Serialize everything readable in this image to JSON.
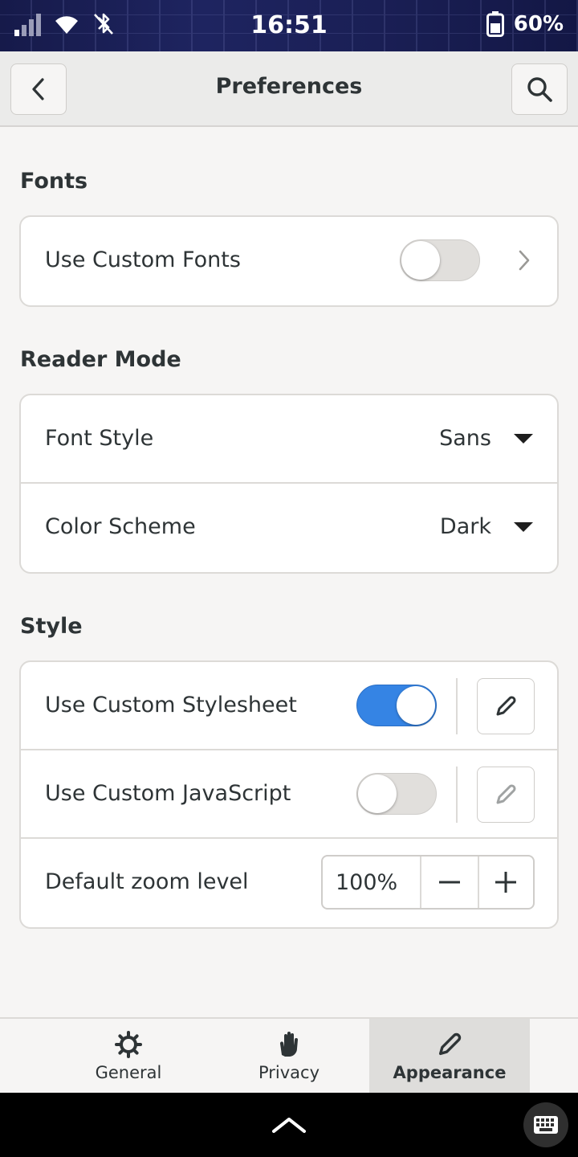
{
  "status_bar": {
    "time": "16:51",
    "battery": "60%"
  },
  "header": {
    "title": "Preferences"
  },
  "fonts": {
    "section_title": "Fonts",
    "use_custom_fonts": {
      "label": "Use Custom Fonts",
      "enabled": false
    }
  },
  "reader_mode": {
    "section_title": "Reader Mode",
    "font_style": {
      "label": "Font Style",
      "value": "Sans"
    },
    "color_scheme": {
      "label": "Color Scheme",
      "value": "Dark"
    }
  },
  "style": {
    "section_title": "Style",
    "custom_stylesheet": {
      "label": "Use Custom Stylesheet",
      "enabled": true
    },
    "custom_javascript": {
      "label": "Use Custom JavaScript",
      "enabled": false
    },
    "zoom": {
      "label": "Default zoom level",
      "value": "100%"
    }
  },
  "tabs": [
    {
      "label": "General",
      "icon": "gear-icon",
      "active": false
    },
    {
      "label": "Privacy",
      "icon": "hand-icon",
      "active": false
    },
    {
      "label": "Appearance",
      "icon": "pencil-icon",
      "active": true
    }
  ],
  "colors": {
    "accent": "#3584e4",
    "background": "#f6f5f4",
    "card": "#ffffff",
    "text": "#2e3436"
  }
}
